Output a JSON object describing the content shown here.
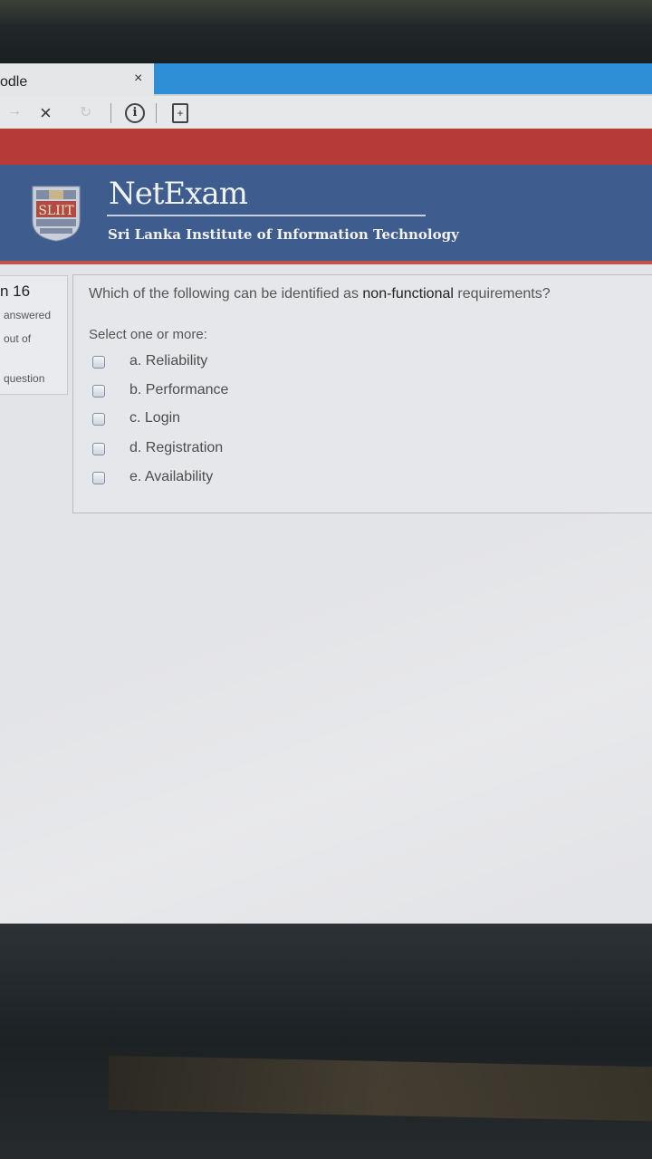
{
  "browser": {
    "tab_title": "odle",
    "tab_close": "×",
    "nav": {
      "back": "→",
      "stop": "×",
      "reload": "↻",
      "info": "i",
      "bookmark": "+"
    }
  },
  "header": {
    "brand": "NetExam",
    "subtitle": "Sri Lanka Institute of Information Technology",
    "logo_text": "SLIIT"
  },
  "question_info": {
    "number": "n 16",
    "state": "answered",
    "marks": "out of",
    "flag": "question"
  },
  "question": {
    "text_before": "Which of the following can be identified as ",
    "text_emph": "non-functional",
    "text_after": " requirements?",
    "prompt": "Select one or more:",
    "options": [
      {
        "label": "a. Reliability",
        "checked": false
      },
      {
        "label": "b. Performance",
        "checked": false
      },
      {
        "label": "c. Login",
        "checked": false
      },
      {
        "label": "d. Registration",
        "checked": false
      },
      {
        "label": "e. Availability",
        "checked": false
      }
    ]
  },
  "colors": {
    "header_bg": "#3e5d8e",
    "accent_red": "#b63a36",
    "tab_blue": "#2f8fd6"
  }
}
